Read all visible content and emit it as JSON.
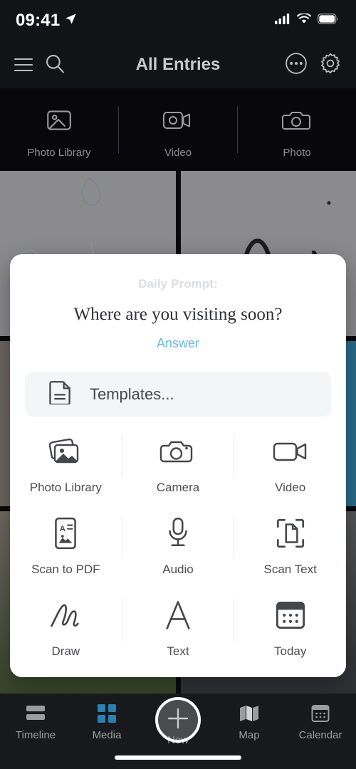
{
  "status_bar": {
    "time": "09:41",
    "location_icon": "location-arrow-icon",
    "cellular_icon": "cellular-signal-icon",
    "wifi_icon": "wifi-icon",
    "battery_icon": "battery-icon"
  },
  "nav_bar": {
    "title": "All Entries",
    "menu_icon": "hamburger-menu-icon",
    "search_icon": "search-icon",
    "more_icon": "more-ellipsis-icon",
    "settings_icon": "gear-icon"
  },
  "quick_bar": {
    "items": [
      {
        "label": "Photo Library",
        "icon": "photo-image-icon"
      },
      {
        "label": "Video",
        "icon": "video-camera-icon"
      },
      {
        "label": "Photo",
        "icon": "camera-icon"
      }
    ]
  },
  "sheet": {
    "prompt_kicker": "Daily Prompt:",
    "prompt_question": "Where are you visiting soon?",
    "answer_label": "Answer",
    "templates_label": "Templates...",
    "templates_icon": "document-lines-icon",
    "actions": [
      [
        {
          "label": "Photo Library",
          "icon": "photo-stack-icon"
        },
        {
          "label": "Camera",
          "icon": "camera-icon"
        },
        {
          "label": "Video",
          "icon": "video-camera-icon"
        }
      ],
      [
        {
          "label": "Scan to PDF",
          "icon": "scan-pdf-icon"
        },
        {
          "label": "Audio",
          "icon": "microphone-icon"
        },
        {
          "label": "Scan Text",
          "icon": "scan-text-icon"
        }
      ],
      [
        {
          "label": "Draw",
          "icon": "scribble-draw-icon"
        },
        {
          "label": "Text",
          "icon": "text-letter-a-icon"
        },
        {
          "label": "Today",
          "icon": "calendar-icon"
        }
      ]
    ]
  },
  "tab_bar": {
    "tabs": [
      {
        "label": "Timeline",
        "icon": "timeline-bars-icon",
        "active": false
      },
      {
        "label": "Media",
        "icon": "media-grid-icon",
        "active": true
      },
      {
        "label": "New",
        "icon": "plus-icon",
        "active": false
      },
      {
        "label": "Map",
        "icon": "map-folded-icon",
        "active": false
      },
      {
        "label": "Calendar",
        "icon": "calendar-icon",
        "active": false
      }
    ]
  },
  "colors": {
    "accent_blue": "#6ab7e8",
    "media_active_blue": "#2c7fae",
    "sheet_bg": "#ffffff",
    "chrome_dark": "#121316",
    "tabbar_dark": "#18191c"
  }
}
